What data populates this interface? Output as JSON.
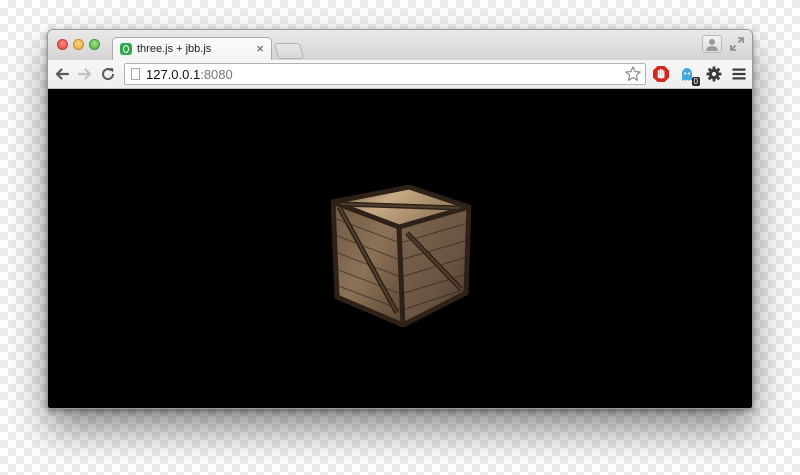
{
  "tab": {
    "title": "three.js + jbb.js",
    "close_glyph": "×",
    "favicon_icon": "green-q-favicon-icon"
  },
  "address_bar": {
    "host": "127.0.0.1",
    "port": ":8080"
  },
  "extensions": {
    "blocker_icon": "red-stop-hand-icon",
    "ghost_icon": "ghostery-icon",
    "ghost_badge": "0"
  },
  "colors": {
    "viewport_background": "#000000",
    "crate_wood": "#8a6a4a"
  },
  "scene": {
    "object": "wooden-crate"
  }
}
